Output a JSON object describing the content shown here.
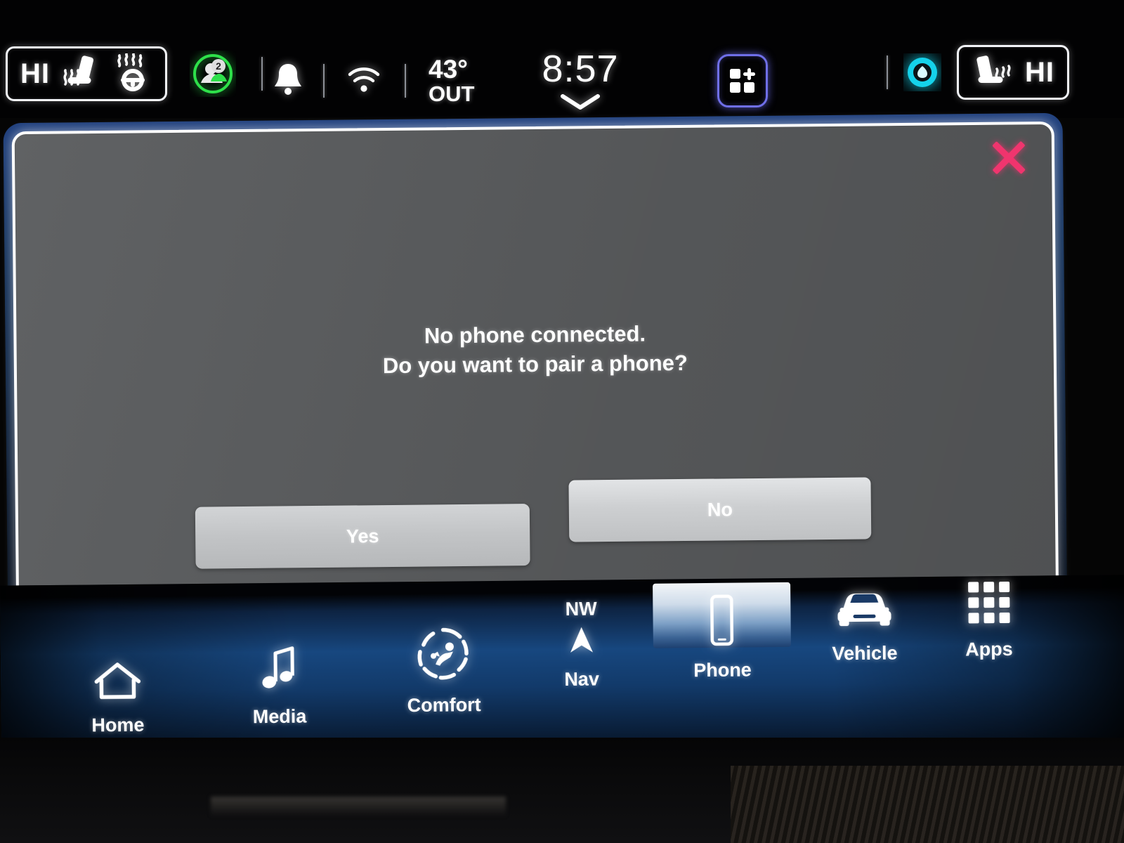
{
  "status_bar": {
    "left_seat_pill": {
      "level_label": "HI",
      "icons": [
        "heated-seat-icon",
        "heated-steering-wheel-icon"
      ]
    },
    "passenger_badge": {
      "icon": "user-profile-icon",
      "value": "2",
      "color": "#2ee04a"
    },
    "notification_icon": "bell-icon",
    "wifi_icon": "wifi-icon",
    "temperature": {
      "value": "43°",
      "label": "OUT"
    },
    "clock": "8:57",
    "expand_icon": "chevron-down-icon",
    "widgets_button": {
      "icon": "add-widget-icon",
      "accent": "#6f6fe8"
    },
    "assistant_icon": {
      "name": "voice-assistant-icon",
      "color": "#18d7f0"
    },
    "right_seat_pill": {
      "level_label": "HI",
      "icons": [
        "ventilated-seat-icon"
      ]
    }
  },
  "dialog": {
    "close_icon": "close-x-icon",
    "close_color": "#f0356e",
    "message_line1": "No phone connected.",
    "message_line2": "Do you want to pair a phone?",
    "buttons": {
      "yes_label": "Yes",
      "no_label": "No"
    },
    "background_color": "#5a5c5e"
  },
  "nav_bar": {
    "items": [
      {
        "id": "home",
        "label": "Home",
        "icon": "home-icon",
        "active": false
      },
      {
        "id": "media",
        "label": "Media",
        "icon": "music-note-icon",
        "active": false
      },
      {
        "id": "comfort",
        "label": "Comfort",
        "icon": "climate-comfort-icon",
        "active": false
      },
      {
        "id": "nav",
        "label": "Nav",
        "icon": "navigation-arrow-icon",
        "active": false,
        "heading": "NW"
      },
      {
        "id": "phone",
        "label": "Phone",
        "icon": "smartphone-icon",
        "active": true
      },
      {
        "id": "vehicle",
        "label": "Vehicle",
        "icon": "car-front-icon",
        "active": false
      },
      {
        "id": "apps",
        "label": "Apps",
        "icon": "grid-apps-icon",
        "active": false
      }
    ],
    "accent_blue": "#17477f"
  }
}
